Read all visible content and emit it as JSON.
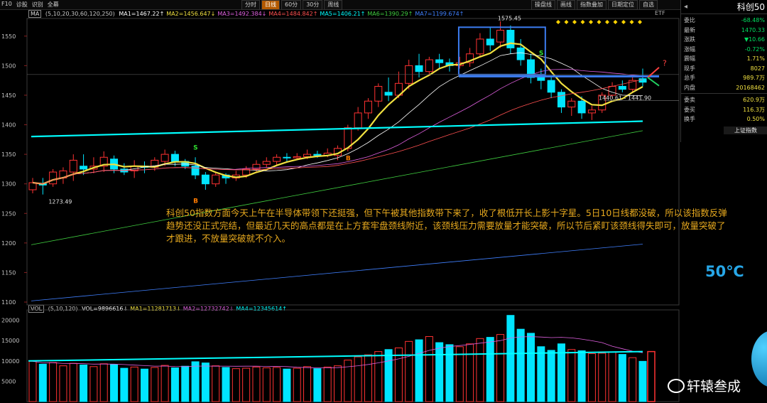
{
  "topbar": {
    "tabs": [
      "F10",
      "诊股",
      "识别",
      "全幕"
    ],
    "periods": [
      "分时",
      "日线",
      "60分",
      "30分",
      "周线"
    ],
    "active_period": "日线",
    "tools": [
      "操盘线",
      "画线",
      "指数叠加",
      "日期定位",
      "自选"
    ]
  },
  "ma_line": {
    "label": "MA",
    "params": "(5,10,20,30,60,120,250)",
    "items": [
      {
        "text": "MA1=1467.22↑",
        "color": "#ffffff"
      },
      {
        "text": "MA2=1456.647↓",
        "color": "#f0e040"
      },
      {
        "text": "MA3=1492.384↓",
        "color": "#e060e0"
      },
      {
        "text": "MA4=1484.842↑",
        "color": "#ff5050"
      },
      {
        "text": "MA5=1406.21↑",
        "color": "#00ffff"
      },
      {
        "text": "MA6=1390.29↑",
        "color": "#40d040"
      },
      {
        "text": "MA7=1199.674↑",
        "color": "#4080ff"
      }
    ],
    "etf": "ETF"
  },
  "vol_line": {
    "label": "VOL",
    "params": "(5,10,120)",
    "items": [
      {
        "text": "VOL=9896616↓",
        "color": "#ffffff"
      },
      {
        "text": "MA1=11281713↓",
        "color": "#f0e040"
      },
      {
        "text": "MA2=12732742↓",
        "color": "#e060e0"
      },
      {
        "text": "MA4=12345614↑",
        "color": "#00ffff"
      }
    ]
  },
  "annotation": "科创50指数方面今天上午在半导体带领下还挺强，但下午被其他指数带下来了，收了根低开长上影十字星。5日10日线都没破，所以该指数反弹趋势还没正式完结，但最近几天的高点都是在上方套牢盘颈线附近，该颈线压力需要放量才能突破，所以节后紧盯该颈线得失即可，放量突破了才跟进，不放量突破就不介入。",
  "temperature": "50℃",
  "watermark": "轩辕叁成",
  "panel": {
    "name": "科创50",
    "rows": [
      {
        "k": "委比",
        "v": "-68.48%",
        "color": "#00e060"
      },
      {
        "k": "最新",
        "v": "1470.33",
        "color": "#00e060"
      },
      {
        "k": "涨跌",
        "v": "▼10.66",
        "color": "#00e060"
      },
      {
        "k": "涨幅",
        "v": "-0.72%",
        "color": "#00e060"
      },
      {
        "k": "震幅",
        "v": "1.71%",
        "color": "#f0e040"
      },
      {
        "k": "现手",
        "v": "8027",
        "color": "#f0e040"
      },
      {
        "k": "总手",
        "v": "989.7万",
        "color": "#f0e040"
      },
      {
        "k": "内盘",
        "v": "20168462",
        "color": "#f0e040"
      },
      {
        "k": "委卖",
        "v": "620.9万",
        "color": "#f0e040"
      },
      {
        "k": "委买",
        "v": "116.3万",
        "color": "#f0e040"
      },
      {
        "k": "换手",
        "v": "0.50%",
        "color": "#f0e040"
      }
    ],
    "bottom_button": "上证指数"
  },
  "price_axis": {
    "labels": [
      "1550",
      "1500",
      "1450",
      "1400",
      "1350",
      "1300",
      "1250",
      "1200",
      "1150",
      "1100"
    ],
    "range": [
      1100,
      1575
    ]
  },
  "vol_axis": {
    "labels": [
      "20000",
      "15000",
      "10000",
      "5000"
    ],
    "range": [
      0,
      21500
    ]
  },
  "chart_data": {
    "type": "candlestick",
    "price_ylim": [
      1100,
      1575
    ],
    "volume_ylim": [
      0,
      21500
    ],
    "annotations": {
      "high_label": "1575.45",
      "low_label": "1273.49",
      "range_label": "1440.61 - 1441.90",
      "buy_marks": [
        "B",
        "B"
      ],
      "sell_marks": [
        "S",
        "S"
      ],
      "question": "?"
    },
    "candles": [
      {
        "o": 1290,
        "c": 1302,
        "h": 1310,
        "l": 1284,
        "v": 9900
      },
      {
        "o": 1300,
        "c": 1298,
        "h": 1310,
        "l": 1282,
        "v": 9200
      },
      {
        "o": 1300,
        "c": 1320,
        "h": 1325,
        "l": 1295,
        "v": 9600
      },
      {
        "o": 1310,
        "c": 1322,
        "h": 1328,
        "l": 1300,
        "v": 8800
      },
      {
        "o": 1320,
        "c": 1340,
        "h": 1350,
        "l": 1305,
        "v": 9400
      },
      {
        "o": 1330,
        "c": 1325,
        "h": 1350,
        "l": 1315,
        "v": 9000
      },
      {
        "o": 1325,
        "c": 1330,
        "h": 1345,
        "l": 1318,
        "v": 8600
      },
      {
        "o": 1330,
        "c": 1345,
        "h": 1355,
        "l": 1320,
        "v": 9300
      },
      {
        "o": 1342,
        "c": 1325,
        "h": 1348,
        "l": 1318,
        "v": 9100
      },
      {
        "o": 1325,
        "c": 1320,
        "h": 1335,
        "l": 1315,
        "v": 8200
      },
      {
        "o": 1322,
        "c": 1330,
        "h": 1340,
        "l": 1310,
        "v": 8500
      },
      {
        "o": 1330,
        "c": 1328,
        "h": 1338,
        "l": 1318,
        "v": 8000
      },
      {
        "o": 1328,
        "c": 1340,
        "h": 1345,
        "l": 1322,
        "v": 8400
      },
      {
        "o": 1338,
        "c": 1350,
        "h": 1358,
        "l": 1330,
        "v": 8900
      },
      {
        "o": 1350,
        "c": 1338,
        "h": 1356,
        "l": 1330,
        "v": 8300
      },
      {
        "o": 1338,
        "c": 1330,
        "h": 1342,
        "l": 1325,
        "v": 8700
      },
      {
        "o": 1330,
        "c": 1315,
        "h": 1345,
        "l": 1308,
        "v": 9800
      },
      {
        "o": 1315,
        "c": 1300,
        "h": 1320,
        "l": 1290,
        "v": 9500
      },
      {
        "o": 1300,
        "c": 1315,
        "h": 1320,
        "l": 1295,
        "v": 8800
      },
      {
        "o": 1315,
        "c": 1310,
        "h": 1318,
        "l": 1300,
        "v": 8400
      },
      {
        "o": 1310,
        "c": 1315,
        "h": 1322,
        "l": 1305,
        "v": 8100
      },
      {
        "o": 1315,
        "c": 1325,
        "h": 1330,
        "l": 1310,
        "v": 8200
      },
      {
        "o": 1325,
        "c": 1333,
        "h": 1340,
        "l": 1320,
        "v": 8500
      },
      {
        "o": 1333,
        "c": 1338,
        "h": 1345,
        "l": 1328,
        "v": 8300
      },
      {
        "o": 1338,
        "c": 1345,
        "h": 1350,
        "l": 1332,
        "v": 8400
      },
      {
        "o": 1345,
        "c": 1344,
        "h": 1352,
        "l": 1338,
        "v": 8000
      },
      {
        "o": 1344,
        "c": 1346,
        "h": 1352,
        "l": 1340,
        "v": 8200
      },
      {
        "o": 1346,
        "c": 1350,
        "h": 1358,
        "l": 1342,
        "v": 8600
      },
      {
        "o": 1350,
        "c": 1348,
        "h": 1356,
        "l": 1344,
        "v": 8100
      },
      {
        "o": 1348,
        "c": 1352,
        "h": 1360,
        "l": 1345,
        "v": 8500
      },
      {
        "o": 1348,
        "c": 1360,
        "h": 1365,
        "l": 1340,
        "v": 8800
      },
      {
        "o": 1360,
        "c": 1395,
        "h": 1400,
        "l": 1355,
        "v": 10200
      },
      {
        "o": 1395,
        "c": 1420,
        "h": 1430,
        "l": 1390,
        "v": 11000
      },
      {
        "o": 1420,
        "c": 1440,
        "h": 1445,
        "l": 1410,
        "v": 11500
      },
      {
        "o": 1440,
        "c": 1465,
        "h": 1470,
        "l": 1430,
        "v": 12300
      },
      {
        "o": 1455,
        "c": 1450,
        "h": 1480,
        "l": 1440,
        "v": 12800
      },
      {
        "o": 1450,
        "c": 1470,
        "h": 1490,
        "l": 1445,
        "v": 13200
      },
      {
        "o": 1470,
        "c": 1500,
        "h": 1510,
        "l": 1460,
        "v": 14800
      },
      {
        "o": 1500,
        "c": 1490,
        "h": 1520,
        "l": 1480,
        "v": 15200
      },
      {
        "o": 1490,
        "c": 1510,
        "h": 1515,
        "l": 1485,
        "v": 16000
      },
      {
        "o": 1510,
        "c": 1505,
        "h": 1520,
        "l": 1495,
        "v": 14500
      },
      {
        "o": 1505,
        "c": 1500,
        "h": 1512,
        "l": 1490,
        "v": 14000
      },
      {
        "o": 1500,
        "c": 1505,
        "h": 1515,
        "l": 1495,
        "v": 13500
      },
      {
        "o": 1505,
        "c": 1520,
        "h": 1530,
        "l": 1498,
        "v": 14200
      },
      {
        "o": 1520,
        "c": 1545,
        "h": 1555,
        "l": 1515,
        "v": 15500
      },
      {
        "o": 1545,
        "c": 1535,
        "h": 1565,
        "l": 1525,
        "v": 15800
      },
      {
        "o": 1540,
        "c": 1560,
        "h": 1575,
        "l": 1530,
        "v": 16500
      },
      {
        "o": 1560,
        "c": 1530,
        "h": 1568,
        "l": 1520,
        "v": 21200
      },
      {
        "o": 1530,
        "c": 1510,
        "h": 1545,
        "l": 1500,
        "v": 17800
      },
      {
        "o": 1510,
        "c": 1480,
        "h": 1520,
        "l": 1470,
        "v": 16800
      },
      {
        "o": 1480,
        "c": 1475,
        "h": 1495,
        "l": 1460,
        "v": 13500
      },
      {
        "o": 1475,
        "c": 1455,
        "h": 1482,
        "l": 1445,
        "v": 12600
      },
      {
        "o": 1455,
        "c": 1430,
        "h": 1460,
        "l": 1420,
        "v": 14200
      },
      {
        "o": 1430,
        "c": 1440,
        "h": 1445,
        "l": 1415,
        "v": 12800
      },
      {
        "o": 1440,
        "c": 1420,
        "h": 1448,
        "l": 1410,
        "v": 12500
      },
      {
        "o": 1420,
        "c": 1425,
        "h": 1432,
        "l": 1408,
        "v": 11800
      },
      {
        "o": 1425,
        "c": 1450,
        "h": 1455,
        "l": 1420,
        "v": 11900
      },
      {
        "o": 1450,
        "c": 1465,
        "h": 1472,
        "l": 1445,
        "v": 12200
      },
      {
        "o": 1465,
        "c": 1460,
        "h": 1475,
        "l": 1455,
        "v": 11600
      },
      {
        "o": 1460,
        "c": 1475,
        "h": 1482,
        "l": 1455,
        "v": 10800
      },
      {
        "o": 1478,
        "c": 1472,
        "h": 1495,
        "l": 1465,
        "v": 9900
      }
    ]
  }
}
